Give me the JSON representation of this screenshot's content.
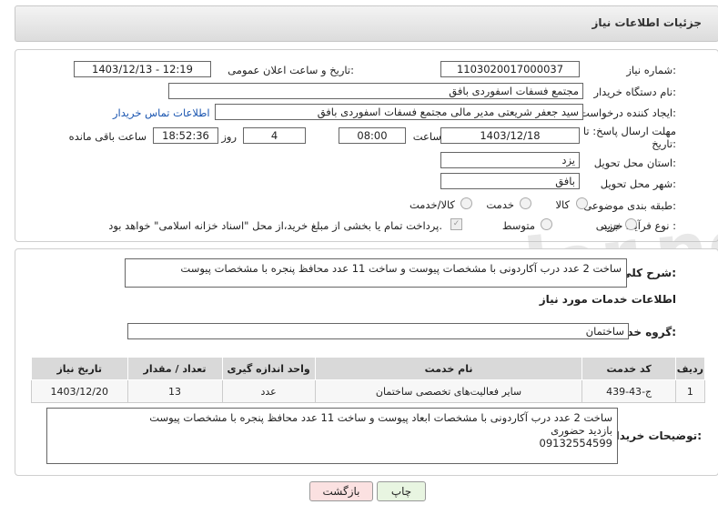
{
  "header": {
    "title": "جزئیات اطلاعات نیاز"
  },
  "form": {
    "need_number_label": "شماره نیاز:",
    "need_number": "1103020017000037",
    "announce_label": "تاریخ و ساعت اعلان عمومی:",
    "announce_value": "1403/12/13 - 12:19",
    "buyer_org_label": "نام دستگاه خریدار:",
    "buyer_org": "مجتمع فسفات اسفوردی بافق",
    "creator_label": "ایجاد کننده درخواست:",
    "creator": "سید جعفر شریعتی مدیر مالی مجتمع فسفات اسفوردی بافق",
    "contact_link": "اطلاعات تماس خریدار",
    "deadline_label_1": "مهلت ارسال پاسخ: تا",
    "deadline_label_2": "تاریخ:",
    "deadline_date": "1403/12/18",
    "time_label": "ساعت",
    "deadline_time": "08:00",
    "days_value": "4",
    "days_label": "روز و",
    "remaining_time": "18:52:36",
    "remaining_label": "ساعت باقی مانده",
    "province_label": "استان محل تحویل:",
    "province": "یزد",
    "city_label": "شهر محل تحویل:",
    "city": "بافق",
    "category_label": "طبقه بندی موضوعی:",
    "category_options": [
      "کالا",
      "خدمت",
      "کالا/خدمت"
    ],
    "process_label": "نوع فرآیند خرید :",
    "process_options": [
      "جزیی",
      "متوسط"
    ],
    "payment_note": "پرداخت تمام یا بخشی از مبلغ خرید،از محل \"اسناد خزانه اسلامی\" خواهد بود."
  },
  "summary": {
    "label": "شرح کلی نیاز:",
    "text": "ساخت 2 عدد درب آکاردونی با مشخصات پیوست و ساخت 11 عدد محافظ پنجره با مشخصات پیوست"
  },
  "services": {
    "section_title": "اطلاعات خدمات مورد نیاز",
    "group_label": "گروه خدمت:",
    "group_value": "ساختمان",
    "columns": [
      "ردیف",
      "کد خدمت",
      "نام خدمت",
      "واحد اندازه گیری",
      "تعداد / مقدار",
      "تاریخ نیاز"
    ],
    "rows": [
      [
        "1",
        "ج-43-439",
        "سایر فعالیت‌های تخصصی ساختمان",
        "عدد",
        "13",
        "1403/12/20"
      ]
    ]
  },
  "buyer_notes": {
    "label": "توضیحات خریدار:",
    "line1": "ساخت 2 عدد درب آکاردونی با مشخصات ابعاد پیوست و ساخت 11 عدد محافظ پنجره با مشخصات پیوست",
    "line2": "بازدید حضوری",
    "line3": "09132554599"
  },
  "buttons": {
    "print": "چاپ",
    "back": "بازگشت"
  },
  "watermark": "AriaTender.neT"
}
